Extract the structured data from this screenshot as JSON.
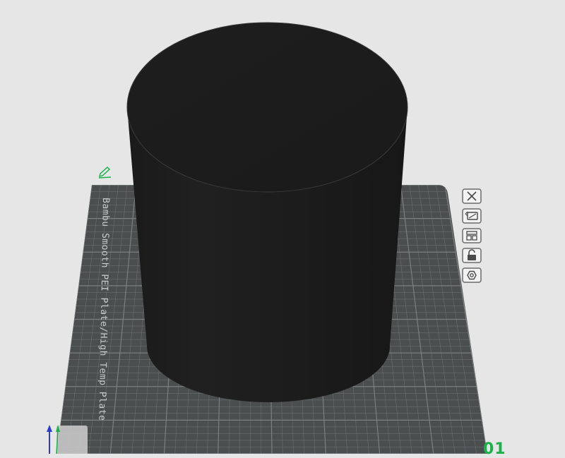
{
  "plate": {
    "label": "Bambu Smooth PEI Plate/High Temp Plate",
    "number": "01"
  },
  "tools": [
    {
      "name": "close",
      "icon": "close-icon"
    },
    {
      "name": "auto-orient",
      "icon": "auto-orient-icon"
    },
    {
      "name": "arrange",
      "icon": "arrange-icon"
    },
    {
      "name": "lock",
      "icon": "lock-icon"
    },
    {
      "name": "settings",
      "icon": "hex-settings-icon"
    }
  ],
  "colors": {
    "background": "#e6e6e6",
    "plate": "#4b4e4e",
    "grid": "#7d8282",
    "model": "#1d1d1d",
    "accent": "#1bb14a",
    "axis_z": "#2b3bd1",
    "axis_y": "#1bb14a"
  }
}
